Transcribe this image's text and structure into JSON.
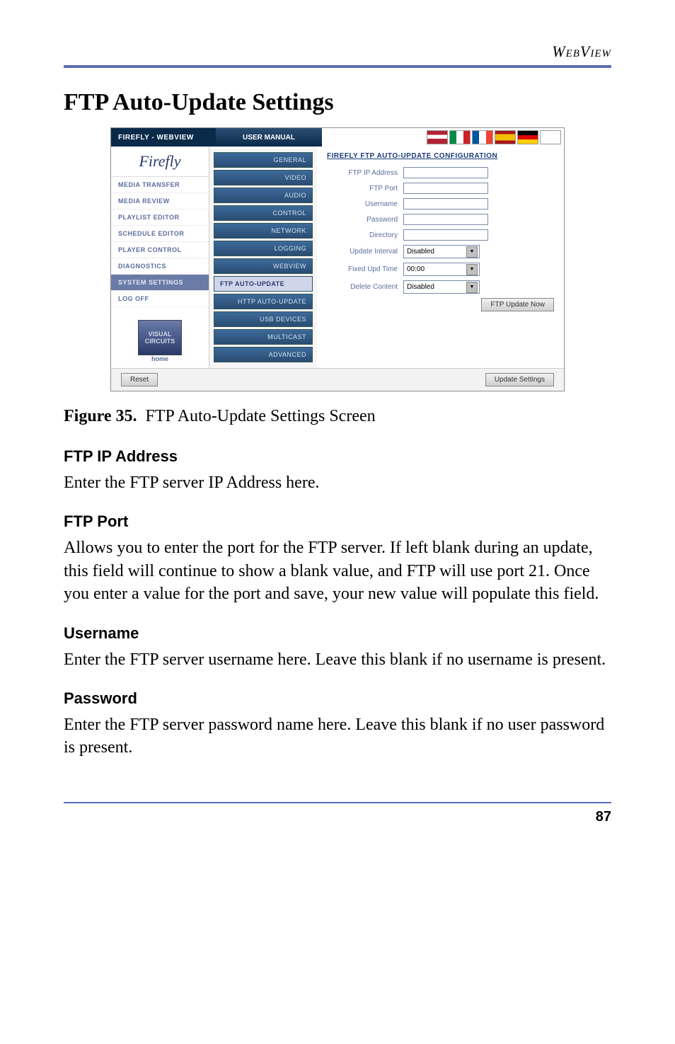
{
  "header": {
    "title": "WebView"
  },
  "section": {
    "title": "FTP Auto-Update Settings"
  },
  "screenshot": {
    "topbar": {
      "product": "FIREFLY - WEBVIEW",
      "manual": "USER MANUAL"
    },
    "brand": "Firefly",
    "leftnav": [
      "MEDIA TRANSFER",
      "MEDIA REVIEW",
      "PLAYLIST EDITOR",
      "SCHEDULE EDITOR",
      "PLAYER CONTROL",
      "DIAGNOSTICS",
      "SYSTEM SETTINGS",
      "LOG OFF"
    ],
    "leftnav_active_index": 6,
    "logo": {
      "line1": "VISUAL",
      "line2": "CIRCUITS",
      "home": "home"
    },
    "subnav": [
      "GENERAL",
      "VIDEO",
      "AUDIO",
      "CONTROL",
      "NETWORK",
      "LOGGING",
      "WEBVIEW",
      "FTP AUTO-UPDATE",
      "HTTP AUTO-UPDATE",
      "USB DEVICES",
      "MULTICAST",
      "ADVANCED"
    ],
    "subnav_active_index": 7,
    "form": {
      "title": "FIREFLY FTP AUTO-UPDATE CONFIGURATION",
      "labels": {
        "ip": "FTP IP Address",
        "port": "FTP Port",
        "user": "Username",
        "pass": "Password",
        "dir": "Directory",
        "interval": "Update Interval",
        "fixed": "Fixed Upd Time",
        "delete": "Delete Content"
      },
      "values": {
        "interval": "Disabled",
        "fixed": "00:00",
        "delete": "Disabled"
      },
      "buttons": {
        "update_now": "FTP Update Now",
        "reset": "Reset",
        "save": "Update Settings"
      }
    }
  },
  "figure": {
    "label": "Figure 35.",
    "caption": "FTP Auto-Update Settings Screen"
  },
  "doc": {
    "h_ip": "FTP IP Address",
    "p_ip": "Enter the FTP server IP Address here.",
    "h_port": "FTP Port",
    "p_port": "Allows you to enter the port for the FTP server. If left blank during an update, this field will continue to show a blank value, and FTP will use port 21. Once you enter a value for the port and save, your new value will populate this field.",
    "h_user": "Username",
    "p_user": "Enter the FTP server username here. Leave this blank if no username is present.",
    "h_pass": "Password",
    "p_pass": "Enter the FTP server password name here. Leave this blank if no user password is present."
  },
  "page_number": "87"
}
